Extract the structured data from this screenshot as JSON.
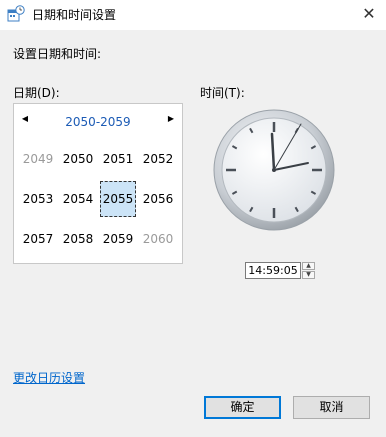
{
  "window": {
    "title": "日期和时间设置",
    "icon": "date-time-settings-icon",
    "close_glyph": "✕"
  },
  "heading": "设置日期和时间:",
  "date_label": "日期(D):",
  "time_label": "时间(T):",
  "calendar": {
    "range": "2050-2059",
    "prev_glyph": "◀",
    "next_glyph": "▶",
    "years": [
      {
        "label": "2049",
        "muted": true
      },
      {
        "label": "2050",
        "muted": false
      },
      {
        "label": "2051",
        "muted": false
      },
      {
        "label": "2052",
        "muted": false
      },
      {
        "label": "2053",
        "muted": false
      },
      {
        "label": "2054",
        "muted": false
      },
      {
        "label": "2055",
        "muted": false,
        "selected": true
      },
      {
        "label": "2056",
        "muted": false
      },
      {
        "label": "2057",
        "muted": false
      },
      {
        "label": "2058",
        "muted": false
      },
      {
        "label": "2059",
        "muted": false
      },
      {
        "label": "2060",
        "muted": true
      }
    ]
  },
  "time": {
    "value": "14:59:05",
    "up_glyph": "▲",
    "down_glyph": "▼"
  },
  "calendar_settings_link": "更改日历设置",
  "buttons": {
    "ok": "确定",
    "cancel": "取消"
  },
  "colors": {
    "accent": "#0078d7",
    "link": "#0066cc",
    "selected_bg": "#cce4f7",
    "range": "#1c5bb5"
  }
}
